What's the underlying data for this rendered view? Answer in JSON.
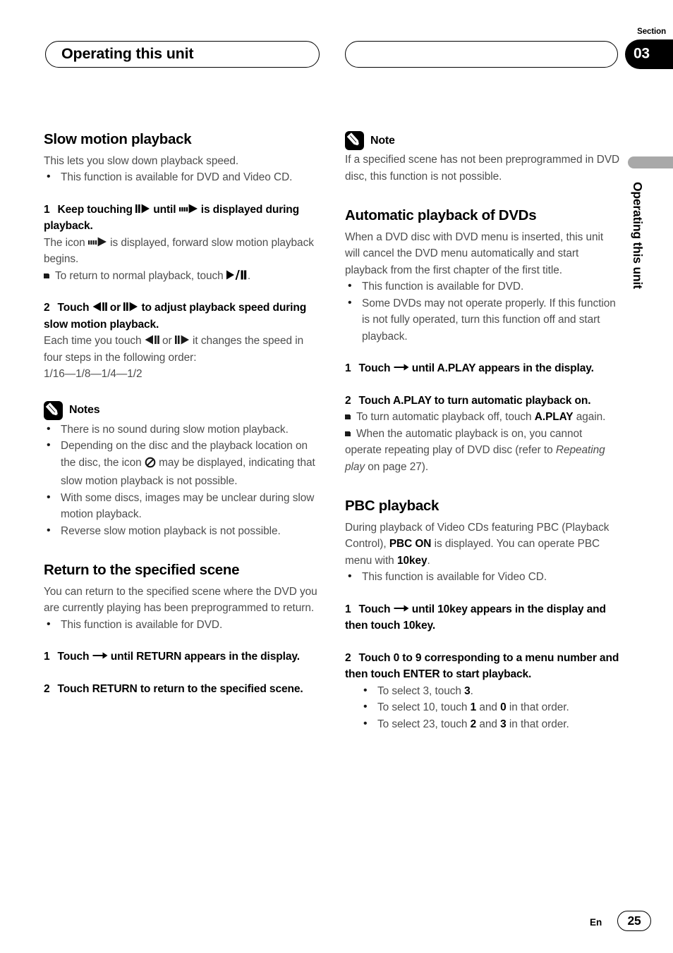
{
  "header": {
    "title": "Operating this unit",
    "section_label": "Section",
    "section_number": "03"
  },
  "side_margin": {
    "vertical_title": "Operating this unit"
  },
  "footer": {
    "language": "En",
    "page_number": "25"
  },
  "left_column": {
    "slow_motion": {
      "heading": "Slow motion playback",
      "intro": "This lets you slow down playback speed.",
      "bullets": [
        "This function is available for DVD and Video CD."
      ],
      "step1": {
        "num": "1",
        "text_a": "Keep touching",
        "text_b": "until",
        "text_c": "is displayed during playback.",
        "icon_a": "frame-advance-icon",
        "icon_b": "slow-motion-icon"
      },
      "step1_body_a": "The icon",
      "step1_body_b": "is displayed, forward slow motion playback begins.",
      "step1_sub": {
        "text_a": "To return to normal playback, touch",
        "text_b": "."
      },
      "step2": {
        "num": "2",
        "text_a": "Touch",
        "text_b": "or",
        "text_c": "to adjust playback speed during slow motion playback."
      },
      "step2_body_a": "Each time you touch",
      "step2_body_b": "or",
      "step2_body_c": "it changes the speed in four steps in the following order:",
      "step2_body_d": "1/16—1/8—1/4—1/2",
      "notes_label": "Notes",
      "notes": [
        "There is no sound during slow motion playback.",
        "Depending on the disc and the playback location on the disc, the icon   may be displayed, indicating that slow motion playback is not possible.",
        "With some discs, images may be unclear during slow motion playback.",
        "Reverse slow motion playback is not possible."
      ],
      "note2_part1": "Depending on the disc and the playback location on the disc, the icon",
      "note2_part2": "may be displayed, indicating that slow motion playback is not possible.",
      "note2_icon": "prohibition-icon"
    },
    "return_scene": {
      "heading": "Return to the specified scene",
      "intro": "You can return to the specified scene where the DVD you are currently playing has been preprogrammed to return.",
      "bullets": [
        "This function is available for DVD."
      ],
      "step1": {
        "num": "1",
        "text_a": "Touch",
        "text_b": "until RETURN appears in the display.",
        "icon": "right-arrow-icon"
      },
      "step2": {
        "num": "2",
        "text": "Touch RETURN to return to the specified scene."
      }
    }
  },
  "right_column": {
    "note_block": {
      "label": "Note",
      "text": "If a specified scene has not been preprogrammed in DVD disc, this function is not possible."
    },
    "auto_playback": {
      "heading": "Automatic playback of DVDs",
      "intro": "When a DVD disc with DVD menu is inserted, this unit will cancel the DVD menu automatically and start playback from the first chapter of the first title.",
      "bullets": [
        "This function is available for DVD.",
        "Some DVDs may not operate properly. If this function is not fully operated, turn this function off and start playback."
      ],
      "step1": {
        "num": "1",
        "text_a": "Touch",
        "text_b": "until A.PLAY appears in the display.",
        "icon": "right-arrow-icon"
      },
      "step2": {
        "num": "2",
        "text": "Touch A.PLAY to turn automatic playback on."
      },
      "sub1_a": "To turn automatic playback off, touch",
      "sub1_bold": "A.PLAY",
      "sub1_b": "again.",
      "sub2_a": "When the automatic playback is on, you cannot operate repeating play of DVD disc (refer to",
      "sub2_italic": "Repeating play",
      "sub2_b": "on page 27)."
    },
    "pbc": {
      "heading": "PBC playback",
      "intro_a": "During playback of Video CDs featuring PBC (Playback Control),",
      "intro_bold1": "PBC ON",
      "intro_b": "is displayed. You can operate PBC menu with",
      "intro_bold2": "10key",
      "intro_c": ".",
      "bullets": [
        "This function is available for Video CD."
      ],
      "step1": {
        "num": "1",
        "text_a": "Touch",
        "text_b": "until 10key appears in the display and then touch 10key.",
        "icon": "right-arrow-icon"
      },
      "step2": {
        "num": "2",
        "text": "Touch 0 to 9 corresponding to a menu number and then touch ENTER to start playback."
      },
      "examples": [
        {
          "a": "To select 3, touch ",
          "b1": "3",
          "mid": "",
          "b2": "",
          "c": "."
        },
        {
          "a": "To select 10, touch ",
          "b1": "1",
          "mid": " and ",
          "b2": "0",
          "c": " in that order."
        },
        {
          "a": "To select 23, touch ",
          "b1": "2",
          "mid": " and ",
          "b2": "3",
          "c": " in that order."
        }
      ]
    }
  }
}
